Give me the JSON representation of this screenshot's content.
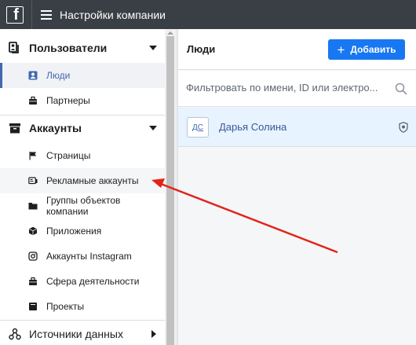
{
  "topbar": {
    "title": "Настройки компании"
  },
  "sidebar": {
    "users_section": "Пользователи",
    "users_items": [
      "Люди",
      "Партнеры"
    ],
    "accounts_section": "Аккаунты",
    "accounts_items": [
      "Страницы",
      "Рекламные аккаунты",
      "Группы объектов компании",
      "Приложения",
      "Аккаунты Instagram",
      "Сфера деятельности",
      "Проекты"
    ],
    "data_sources_section": "Источники данных"
  },
  "main": {
    "title": "Люди",
    "add_label": "Добавить",
    "filter_placeholder": "Фильтровать по имени, ID или электро...",
    "person": {
      "initials": "ДС",
      "name": "Дарья Солина"
    }
  },
  "colors": {
    "accent": "#1877f2",
    "topbar": "#3a3f45",
    "annotation": "#e2231a"
  }
}
